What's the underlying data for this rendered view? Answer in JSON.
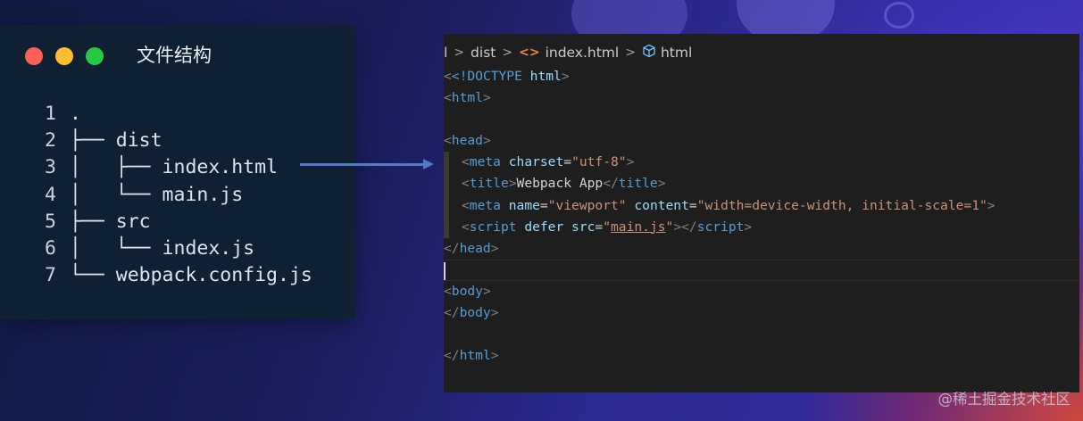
{
  "window": {
    "title": "文件结构",
    "controls": [
      {
        "name": "close",
        "color": "#fe5f57"
      },
      {
        "name": "minimize",
        "color": "#febc2e"
      },
      {
        "name": "maximize",
        "color": "#28c840"
      }
    ]
  },
  "file_tree": [
    {
      "num": "1",
      "text": "."
    },
    {
      "num": "2",
      "text": "├── dist"
    },
    {
      "num": "3",
      "text": "│   ├── index.html"
    },
    {
      "num": "4",
      "text": "│   └── main.js"
    },
    {
      "num": "5",
      "text": "├── src"
    },
    {
      "num": "6",
      "text": "│   └── index.js"
    },
    {
      "num": "7",
      "text": "└── webpack.config.js"
    }
  ],
  "breadcrumb": {
    "partial": "l",
    "folder": "dist",
    "file": "index.html",
    "symbol": "html",
    "icons": [
      "chevron-right-icon",
      "html-tag-icon",
      "cube-icon"
    ]
  },
  "code": {
    "doctype_open": "<!DOCTYPE",
    "doctype_name": "html",
    "html_open": "html",
    "head_open": "head",
    "meta1_tag": "meta",
    "meta1_attr": "charset",
    "meta1_val": "\"utf-8\"",
    "title_tag": "title",
    "title_text": "Webpack App",
    "meta2_tag": "meta",
    "meta2_attr1": "name",
    "meta2_val1": "\"viewport\"",
    "meta2_attr2": "content",
    "meta2_val2": "\"width=device-width, initial-scale=1\"",
    "script_tag": "script",
    "script_attr1": "defer",
    "script_attr2": "src",
    "script_val": "main.js",
    "head_close": "head",
    "body_tag": "body",
    "html_close": "html"
  },
  "watermark": "@稀土掘金技术社区",
  "colors": {
    "tree_panel_bg": "#0f2033",
    "editor_bg": "#1e1e1e",
    "arrow": "#4f79c9",
    "tag": "#569cd6",
    "attr": "#9cdcfe",
    "string": "#ce9178"
  }
}
